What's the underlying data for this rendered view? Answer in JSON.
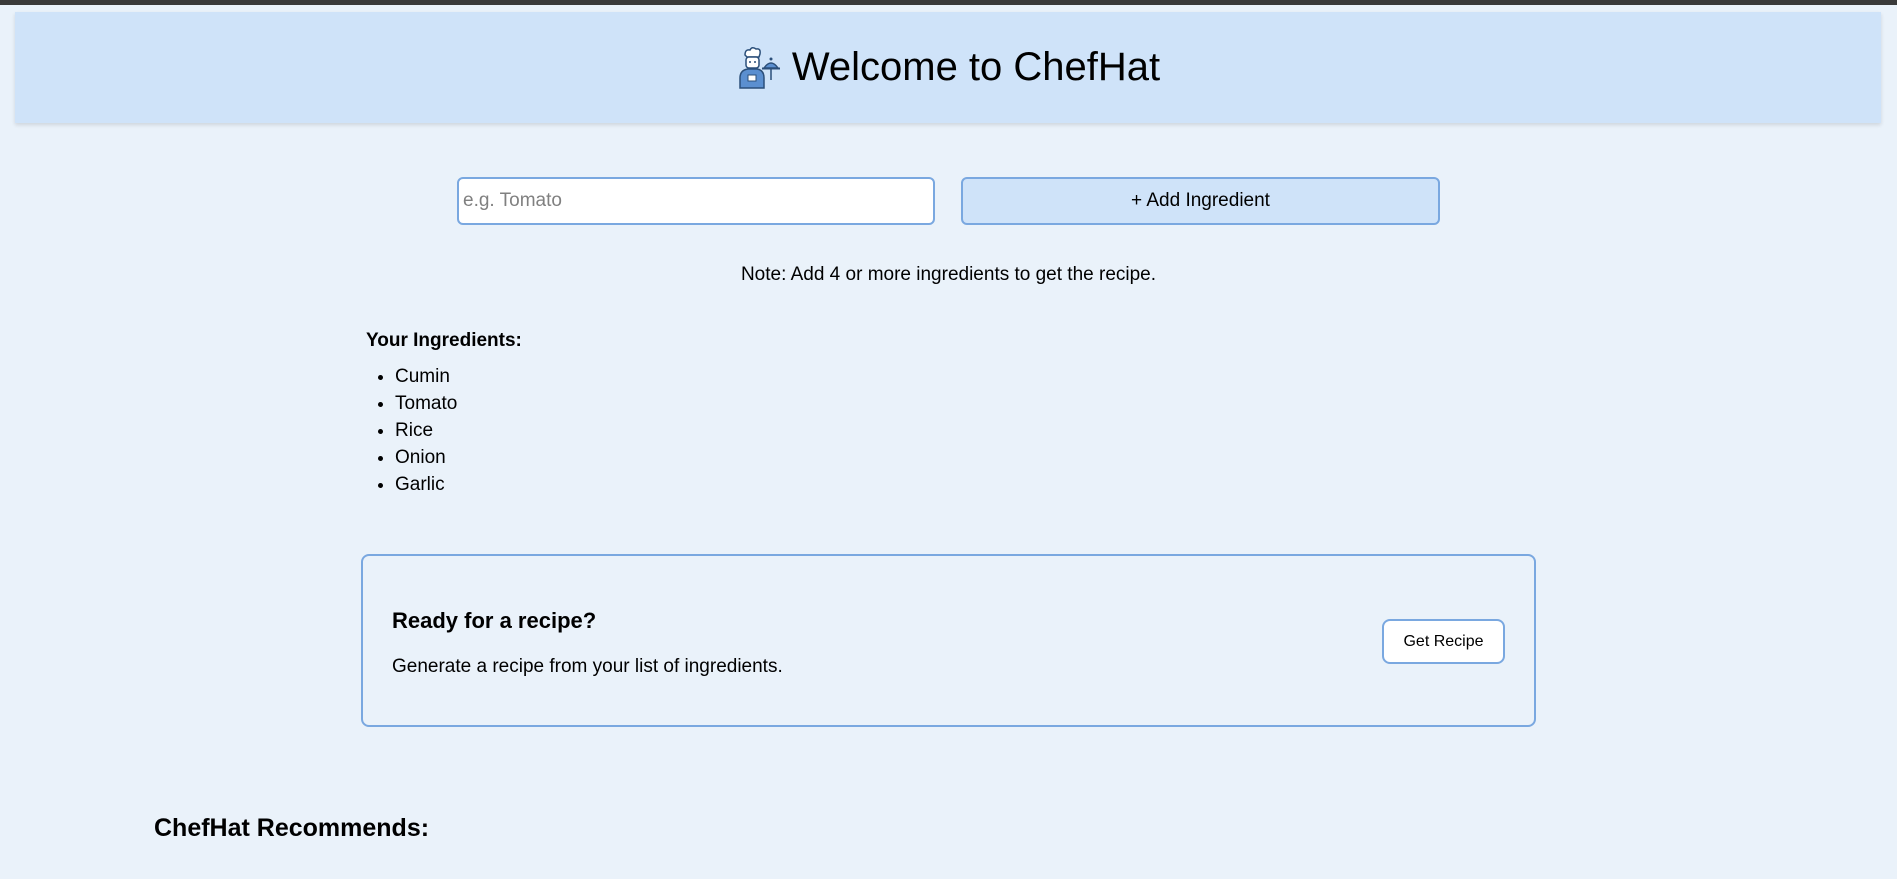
{
  "header": {
    "icon": "chef-icon",
    "title": "Welcome to ChefHat"
  },
  "form": {
    "input_placeholder": "e.g. Tomato",
    "input_value": "",
    "add_button_label": "+ Add Ingredient"
  },
  "note": "Note: Add 4 or more ingredients to get the recipe.",
  "ingredients": {
    "heading": "Your Ingredients:",
    "items": [
      "Cumin",
      "Tomato",
      "Rice",
      "Onion",
      "Garlic"
    ]
  },
  "recipe_prompt": {
    "heading": "Ready for a recipe?",
    "description": "Generate a recipe from your list of ingredients.",
    "button_label": "Get Recipe"
  },
  "recommends": {
    "heading": "ChefHat Recommends:"
  },
  "colors": {
    "background": "#eaf2fa",
    "header_bg": "#cfe3f9",
    "accent_border": "#7aa8e0",
    "icon_blue": "#5b8fd0"
  }
}
